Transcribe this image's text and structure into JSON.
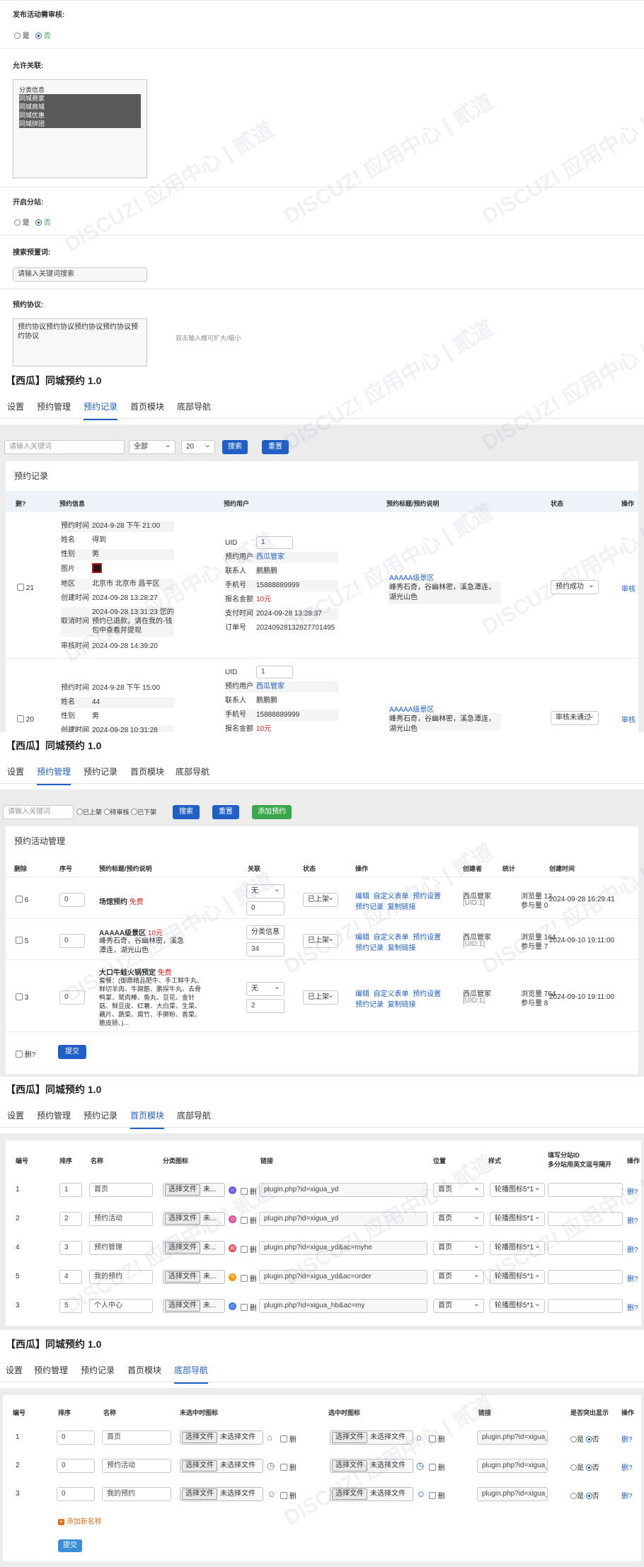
{
  "settings": {
    "review_label": "发布活动需审核:",
    "yes": "是",
    "no": "否",
    "allow_link_label": "允许关联:",
    "link_options": [
      "分类信息",
      "同城商家",
      "同城商城",
      "同城优惠",
      "同城拼团"
    ],
    "fenzhan_label": "开启分站:",
    "search_hint_label": "搜索预置词:",
    "search_hint_value": "请输入关键词搜索",
    "agreement_label": "预约协议:",
    "agreement_value": "预约协议预约协议预约协议预约协议预约协议",
    "agreement_hint": "双击输入框可扩大/缩小"
  },
  "app_title": "【西瓜】同城预约 1.0",
  "tabs": [
    "设置",
    "预约管理",
    "预约记录",
    "首页模块",
    "底部导航"
  ],
  "records": {
    "search_placeholder": "请输入关键词",
    "filter_all": "全部",
    "page_size": "20",
    "search_btn": "搜索",
    "reset_btn": "重置",
    "panel_title": "预约记录",
    "headers": [
      "删?",
      "预约信息",
      "预约用户",
      "预约标题/预约说明",
      "状态",
      "操作"
    ],
    "rows": [
      {
        "id": "21",
        "info": [
          [
            "预约时间",
            "2024-9-28 下午 21:00"
          ],
          [
            "姓名",
            "得到"
          ],
          [
            "性别",
            "男"
          ],
          [
            "图片",
            ""
          ],
          [
            "地区",
            "北京市 北京市 昌平区"
          ],
          [
            "创建时间",
            "2024-09-28 13:28:27"
          ],
          [
            "取消时间",
            "2024-09-28 13:31:23 您的预约已退款，请在我的-钱包中查看并提现"
          ],
          [
            "审核时间",
            "2024-09-28 14:39:20"
          ]
        ],
        "uid": "1",
        "user": [
          [
            "预约用户",
            "西瓜管家"
          ],
          [
            "联系人",
            "鹏鹏鹏"
          ],
          [
            "手机号",
            "15888889999"
          ],
          [
            "报名金额",
            "10元"
          ],
          [
            "支付时间",
            "2024-09-28 13:28:37"
          ],
          [
            "订单号",
            "20240928132827701495"
          ]
        ],
        "title": "AAAAA级景区",
        "desc": "峰秀石奇，谷幽林密，溪急潭连，湖光山色",
        "status": "预约成功",
        "action": "审核"
      },
      {
        "id": "20",
        "info": [
          [
            "预约时间",
            "2024-9-28 下午 15:00"
          ],
          [
            "姓名",
            "44"
          ],
          [
            "性别",
            "男"
          ],
          [
            "创建时间",
            "2024-09-28 10:31:28"
          ]
        ],
        "uid": "1",
        "user": [
          [
            "预约用户",
            "西瓜管家"
          ],
          [
            "联系人",
            "鹏鹏鹏"
          ],
          [
            "手机号",
            "15888889999"
          ],
          [
            "报名金额",
            "10元"
          ]
        ],
        "title": "AAAAA级景区",
        "desc": "峰秀石奇，谷幽林密，溪急潭连，湖光山色",
        "status": "审核未通过",
        "action": "审核"
      }
    ]
  },
  "manage": {
    "search_placeholder": "请输入关键词",
    "filters": [
      "已上架",
      "待审核",
      "已下架"
    ],
    "search_btn": "搜索",
    "reset_btn": "重置",
    "add_btn": "添加预约",
    "panel_title": "预约活动管理",
    "headers": [
      "删除",
      "序号",
      "预约标题/预约说明",
      "关联",
      "状态",
      "操作",
      "创建者",
      "统计",
      "创建时间"
    ],
    "rows": [
      {
        "id": "6",
        "order": "0",
        "title": "场馆预约",
        "tag": "免费",
        "desc": "",
        "rel": "无",
        "rel_val": "0",
        "status": "已上架",
        "ops1": [
          "编辑",
          "自定义表单",
          "预约设置"
        ],
        "ops2": [
          "预约记录",
          "复制链接"
        ],
        "creator": "西瓜管家",
        "creator_uid": "[UID:1]",
        "views": "浏览量 12",
        "joins": "参与量 0",
        "created": "2024-09-28 16:29:41"
      },
      {
        "id": "5",
        "order": "0",
        "title": "AAAAA级景区",
        "tag": "10元",
        "desc": "峰秀石奇，谷幽林密，溪急潭连，湖光山色",
        "rel": "分类信息",
        "rel_val": "34",
        "status": "已上架",
        "ops1": [
          "编辑",
          "自定义表单",
          "预约设置"
        ],
        "ops2": [
          "预约记录",
          "复制链接"
        ],
        "creator": "西瓜管家",
        "creator_uid": "[UID:1]",
        "views": "浏览量 164",
        "joins": "参与量 7",
        "created": "2024-09-10 19:11:00"
      },
      {
        "id": "3",
        "order": "0",
        "title": "大口牛蛙火锅预定",
        "tag": "免费",
        "desc": "套餐：(御鼎精品肥牛、手工鲜牛丸、鲜切羊肉、牛蹄筋、鹏探牛丸、去骨鸭掌、鹫肉棒、鱼丸、豆花、金针菇、鲜豆皮、红薯、大白菜、生菜、藕片、蔬菜、腐竹、手擀粉、香菜、脆皮肠、)...",
        "rel": "无",
        "rel_val": "2",
        "status": "已上架",
        "ops1": [
          "编辑",
          "自定义表单",
          "预约设置"
        ],
        "ops2": [
          "预约记录",
          "复制链接"
        ],
        "creator": "西瓜管家",
        "creator_uid": "[UID:1]",
        "views": "浏览量 764",
        "joins": "参与量 8",
        "created": "2024-09-10 19:11:00"
      }
    ],
    "delete_label": "删?",
    "submit_btn": "提交"
  },
  "home": {
    "headers": [
      "编号",
      "排序",
      "名称",
      "分类图标",
      "链接",
      "位置",
      "样式",
      "填写分站ID",
      "多分站用英文逗号隔开",
      "操作"
    ],
    "choose_file": "选择文件",
    "no_file_short": "未...",
    "del": "删",
    "rows": [
      {
        "num": "1",
        "order": "1",
        "name": "首页",
        "icon_color": "#6c5ce7",
        "icon": "⌂",
        "link": "plugin.php?id=xigua_yd",
        "pos": "首页",
        "style": "轮播图标5*1",
        "op": "删?"
      },
      {
        "num": "2",
        "order": "2",
        "name": "预约活动",
        "icon_color": "#e84393",
        "icon": "◷",
        "link": "plugin.php?id=xigua_yd",
        "pos": "首页",
        "style": "轮播图标5*1",
        "op": "删?"
      },
      {
        "num": "4",
        "order": "3",
        "name": "预约管理",
        "icon_color": "#e84354",
        "icon": "▤",
        "link": "plugin.php?id=xigua_yd&ac=myhe",
        "pos": "首页",
        "style": "轮播图标5*1",
        "op": "删?"
      },
      {
        "num": "5",
        "order": "4",
        "name": "我的预约",
        "icon_color": "#f39c12",
        "icon": "✎",
        "link": "plugin.php?id=xigua_yd&ac=order",
        "pos": "首页",
        "style": "轮播图标5*1",
        "op": "删?"
      },
      {
        "num": "3",
        "order": "5",
        "name": "个人中心",
        "icon_color": "#4a7cf0",
        "icon": "☺",
        "link": "plugin.php?id=xigua_hb&ac=my",
        "pos": "首页",
        "style": "轮播图标5*1",
        "op": "删?"
      }
    ]
  },
  "nav": {
    "headers": [
      "编号",
      "排序",
      "名称",
      "未选中时图标",
      "选中时图标",
      "链接",
      "是否突出显示",
      "操作"
    ],
    "choose_file": "选择文件",
    "no_file": "未选择文件",
    "del": "删",
    "yes": "是",
    "no": "否",
    "rows": [
      {
        "num": "1",
        "order": "0",
        "name": "首页",
        "icon": "⌂",
        "link": "plugin.php?id=xigua_hb",
        "op": "删?"
      },
      {
        "num": "2",
        "order": "0",
        "name": "预约活动",
        "icon": "◷",
        "link": "plugin.php?id=xigua_yc",
        "op": "删?"
      },
      {
        "num": "3",
        "order": "0",
        "name": "我的预约",
        "icon": "☺",
        "link": "plugin.php?id=xigua_yc",
        "op": "删?"
      }
    ],
    "add_new": "添加新名称",
    "submit_btn": "提交"
  }
}
